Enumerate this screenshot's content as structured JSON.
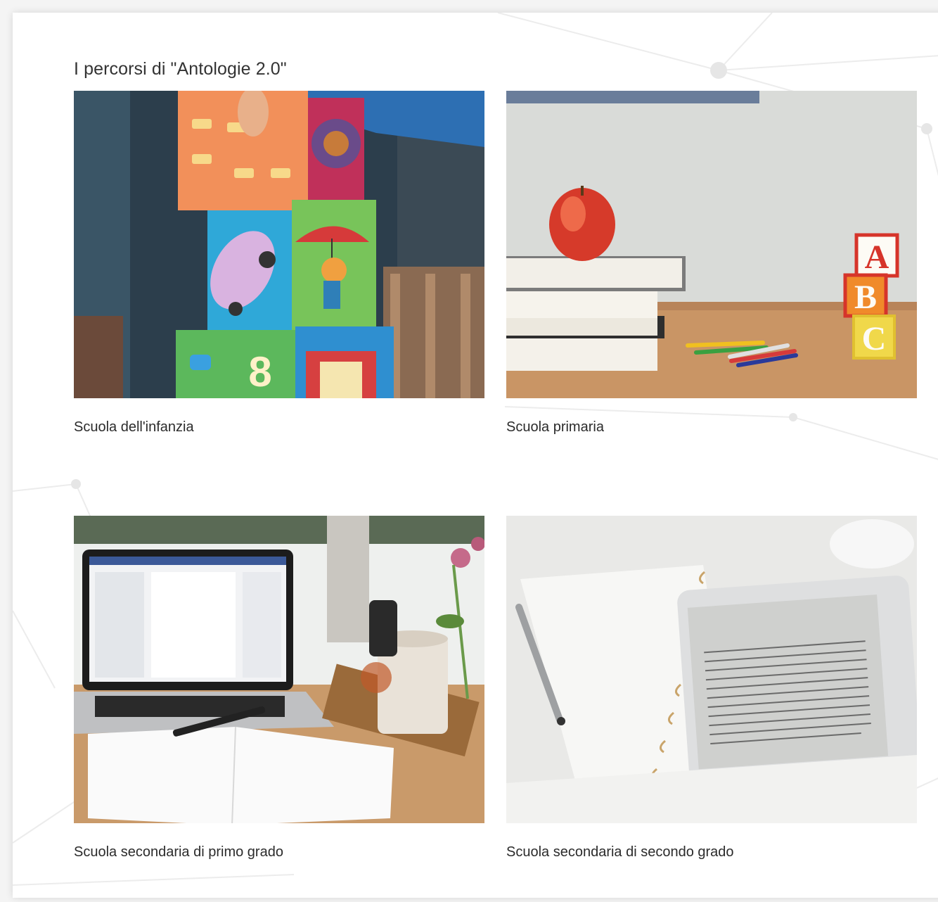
{
  "section": {
    "title": "I percorsi di \"Antologie 2.0\""
  },
  "cards": [
    {
      "label": "Scuola dell'infanzia",
      "image": "toy-blocks-photo"
    },
    {
      "label": "Scuola primaria",
      "image": "apple-books-abc-blocks-photo"
    },
    {
      "label": "Scuola secondaria di primo grado",
      "image": "laptop-notebook-desk-photo"
    },
    {
      "label": "Scuola secondaria di secondo grado",
      "image": "ereader-notebook-photo"
    }
  ],
  "illustration_text": {
    "block_a": "A",
    "block_b": "B",
    "block_c": "C",
    "block_8": "8"
  }
}
